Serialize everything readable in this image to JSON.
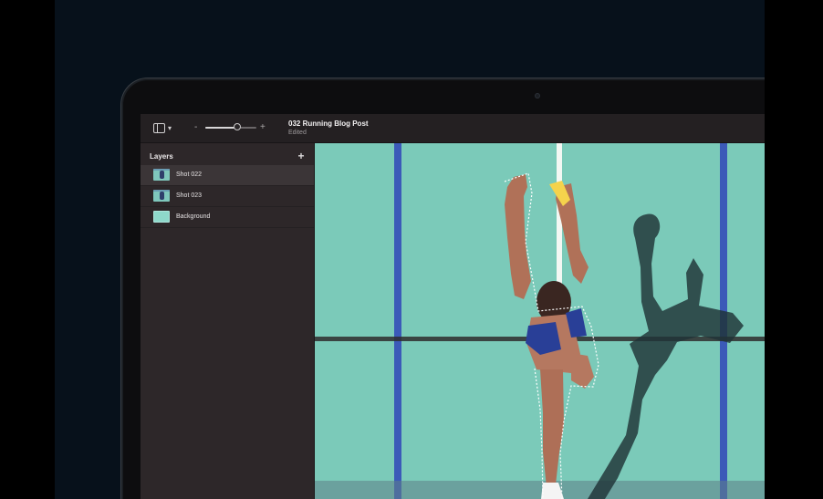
{
  "document": {
    "title": "032 Running Blog Post",
    "status": "Edited"
  },
  "toolbar": {
    "sidebar_toggle_icon": "sidebar-toggle-icon",
    "zoom_minus": "-",
    "zoom_plus": "+",
    "zoom_level_fraction": 0.62
  },
  "layers": {
    "title": "Layers",
    "add_label": "+",
    "items": [
      {
        "label": "Shot 022",
        "thumbnail": "shot-thumbnail",
        "selected": true
      },
      {
        "label": "Shot 023",
        "thumbnail": "shot-thumbnail",
        "selected": false
      },
      {
        "label": "Background",
        "thumbnail": "background-thumbnail",
        "selected": false
      }
    ]
  },
  "canvas": {
    "subject": "running-athlete-cutout",
    "track_color": "#7bcab9",
    "lane_line_color": "#3b5ab8"
  }
}
